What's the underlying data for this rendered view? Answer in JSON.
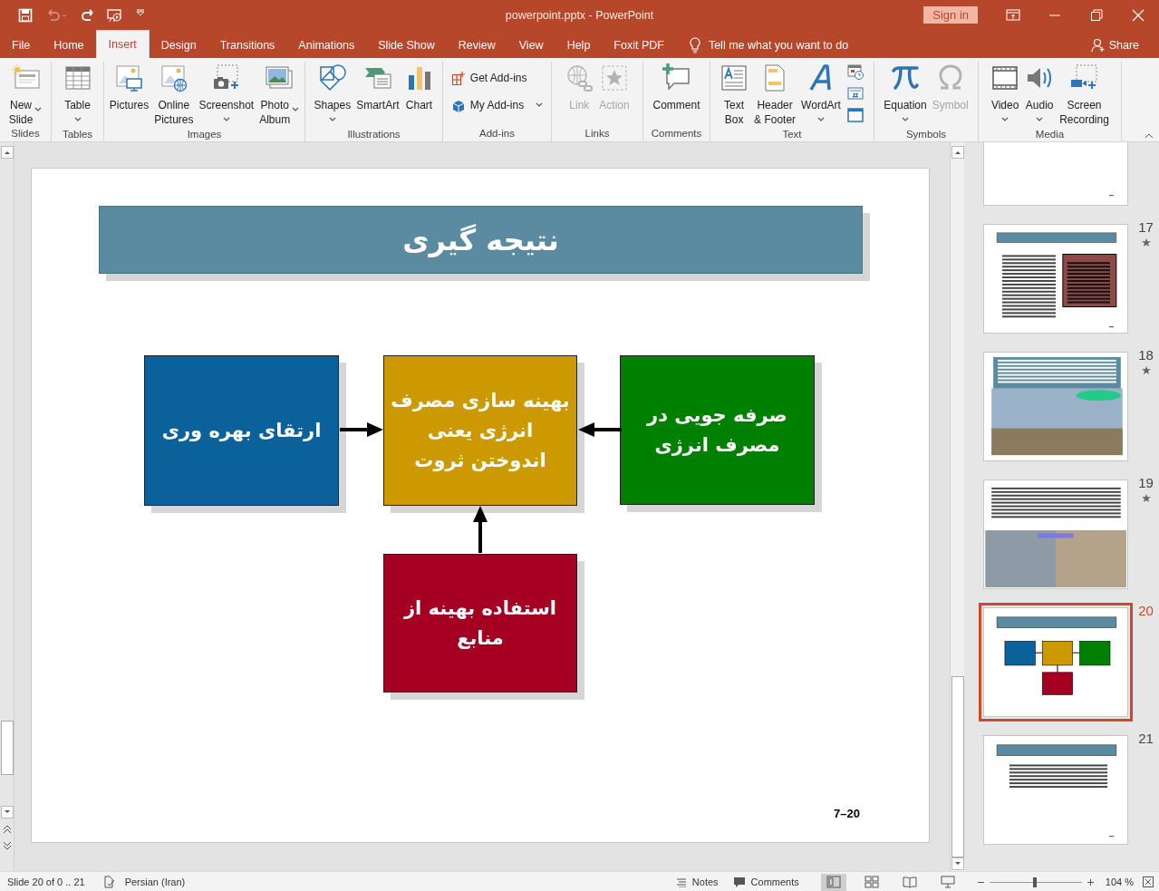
{
  "window": {
    "title": "powerpoint.pptx  -  PowerPoint",
    "sign_in": "Sign in"
  },
  "quick_access": [
    {
      "disabled": false
    },
    {
      "disabled": true
    },
    {
      "disabled": false
    },
    {
      "disabled": false
    },
    {
      "disabled": false
    }
  ],
  "tabs": [
    {
      "label": "File",
      "selected": false
    },
    {
      "label": "Home",
      "selected": false
    },
    {
      "label": "Insert",
      "selected": true
    },
    {
      "label": "Design",
      "selected": false
    },
    {
      "label": "Transitions",
      "selected": false
    },
    {
      "label": "Animations",
      "selected": false
    },
    {
      "label": "Slide Show",
      "selected": false
    },
    {
      "label": "Review",
      "selected": false
    },
    {
      "label": "View",
      "selected": false
    },
    {
      "label": "Help",
      "selected": false
    },
    {
      "label": "Foxit PDF",
      "selected": false
    }
  ],
  "tell_me": "Tell me what you want to do",
  "share": "Share",
  "ribbon_groups": [
    {
      "label": "Slides",
      "buttons": [
        {
          "kind": "large",
          "label": "New\nSlide",
          "dropdown": true,
          "disabled": false
        }
      ]
    },
    {
      "label": "Tables",
      "buttons": [
        {
          "kind": "large",
          "label": "Table",
          "dropdown": true,
          "disabled": false
        }
      ]
    },
    {
      "label": "Images",
      "buttons": [
        {
          "kind": "large",
          "label": "Pictures",
          "dropdown": false,
          "disabled": false
        },
        {
          "kind": "large",
          "label": "Online\nPictures",
          "dropdown": false,
          "disabled": false
        },
        {
          "kind": "large",
          "label": "Screenshot",
          "dropdown": true,
          "disabled": false
        },
        {
          "kind": "large",
          "label": "Photo\nAlbum",
          "dropdown": true,
          "disabled": false
        }
      ]
    },
    {
      "label": "Illustrations",
      "buttons": [
        {
          "kind": "large",
          "label": "Shapes",
          "dropdown": true,
          "disabled": false
        },
        {
          "kind": "large",
          "label": "SmartArt",
          "dropdown": false,
          "disabled": false
        },
        {
          "kind": "large",
          "label": "Chart",
          "dropdown": false,
          "disabled": false
        }
      ]
    },
    {
      "label": "Add-ins",
      "buttons": [
        {
          "kind": "small",
          "label": "Get Add-ins",
          "dropdown": false,
          "disabled": false
        },
        {
          "kind": "small",
          "label": "My Add-ins",
          "dropdown": true,
          "disabled": false
        }
      ]
    },
    {
      "label": "Links",
      "buttons": [
        {
          "kind": "large",
          "label": "Link",
          "dropdown": false,
          "disabled": true
        },
        {
          "kind": "large",
          "label": "Action",
          "dropdown": false,
          "disabled": true
        }
      ]
    },
    {
      "label": "Comments",
      "buttons": [
        {
          "kind": "large",
          "label": "Comment",
          "dropdown": false,
          "disabled": false
        }
      ]
    },
    {
      "label": "Text",
      "buttons": [
        {
          "kind": "large",
          "label": "Text\nBox",
          "dropdown": false,
          "disabled": false
        },
        {
          "kind": "large",
          "label": "Header\n& Footer",
          "dropdown": false,
          "disabled": false
        },
        {
          "kind": "large",
          "label": "WordArt",
          "dropdown": true,
          "disabled": false
        },
        {
          "kind": "icon",
          "disabled": false
        },
        {
          "kind": "icon",
          "disabled": false
        },
        {
          "kind": "icon",
          "disabled": false
        }
      ]
    },
    {
      "label": "Symbols",
      "buttons": [
        {
          "kind": "large",
          "label": "Equation",
          "dropdown": true,
          "disabled": false
        },
        {
          "kind": "large",
          "label": "Symbol",
          "dropdown": false,
          "disabled": true
        }
      ]
    },
    {
      "label": "Media",
      "buttons": [
        {
          "kind": "large",
          "label": "Video",
          "dropdown": true,
          "disabled": false
        },
        {
          "kind": "large",
          "label": "Audio",
          "dropdown": true,
          "disabled": false
        },
        {
          "kind": "large",
          "label": "Screen\nRecording",
          "dropdown": false,
          "disabled": false
        }
      ]
    }
  ],
  "slide": {
    "title": "نتیجه گیری",
    "boxes": [
      {
        "text": "صرفه جویی در مصرف انرژی",
        "color": "#008000"
      },
      {
        "text": "بهینه سازی مصرف انرژی یعنی اندوختن ثروت",
        "color": "#cc9900"
      },
      {
        "text": "ارتقای بهره وری",
        "color": "#0b6199"
      },
      {
        "text": "استفاده بهینه از منابع",
        "color": "#a50021"
      }
    ],
    "slide_number": "7–20"
  },
  "thumbnails": [
    {
      "kind": "text",
      "selected": false
    },
    {
      "number": "17",
      "kind": "text-block",
      "animated": true,
      "selected": false
    },
    {
      "number": "18",
      "kind": "banner-photo",
      "animated": true,
      "selected": false
    },
    {
      "number": "19",
      "kind": "text-photo",
      "animated": true,
      "selected": false
    },
    {
      "number": "20",
      "kind": "diagram",
      "animated": false,
      "selected": true
    },
    {
      "number": "21",
      "kind": "title-text",
      "animated": false,
      "selected": false
    }
  ],
  "status_bar": {
    "slide_info": "Slide 20 of 0 .. 21",
    "language": "Persian (Iran)",
    "notes": "Notes",
    "comments": "Comments",
    "views": [
      {
        "selected": true
      },
      {
        "selected": false
      },
      {
        "selected": false
      },
      {
        "selected": false
      }
    ],
    "zoom": {
      "level": 0.49,
      "reading": "104 %"
    }
  }
}
